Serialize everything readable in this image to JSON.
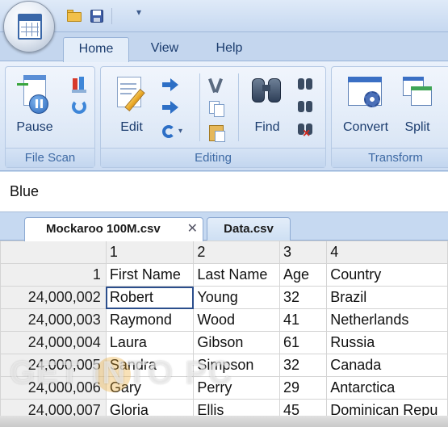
{
  "quick_access": {
    "open_icon": "folder-icon",
    "save_icon": "save-disk-icon",
    "more_glyph": "▾"
  },
  "ribbon_tabs": [
    {
      "label": "Home",
      "active": true
    },
    {
      "label": "View",
      "active": false
    },
    {
      "label": "Help",
      "active": false
    }
  ],
  "groups": {
    "file_scan": {
      "label": "File Scan",
      "pause_label": "Pause"
    },
    "editing": {
      "label": "Editing",
      "edit_label": "Edit",
      "find_label": "Find",
      "undo_dropdown": "▾"
    },
    "transform": {
      "label": "Transform",
      "convert_label": "Convert",
      "split_label": "Split"
    }
  },
  "value_bar": {
    "text": "Blue"
  },
  "document_tabs": [
    {
      "label": "Mockaroo 100M.csv",
      "active": true,
      "close": "✕"
    },
    {
      "label": "Data.csv",
      "active": false
    }
  ],
  "grid": {
    "column_headers": [
      "",
      "1",
      "2",
      "3",
      "4"
    ],
    "rows": [
      {
        "row": "1",
        "cells": [
          "First Name",
          "Last Name",
          "Age",
          "Country"
        ]
      },
      {
        "row": "24,000,002",
        "cells": [
          "Robert",
          "Young",
          "32",
          "Brazil"
        ]
      },
      {
        "row": "24,000,003",
        "cells": [
          "Raymond",
          "Wood",
          "41",
          "Netherlands"
        ]
      },
      {
        "row": "24,000,004",
        "cells": [
          "Laura",
          "Gibson",
          "61",
          "Russia"
        ]
      },
      {
        "row": "24,000,005",
        "cells": [
          "Sandra",
          "Simpson",
          "32",
          "Canada"
        ]
      },
      {
        "row": "24,000,006",
        "cells": [
          "Gary",
          "Perry",
          "29",
          "Antarctica"
        ]
      },
      {
        "row": "24,000,007",
        "cells": [
          "Gloria",
          "Ellis",
          "45",
          "Dominican Repu"
        ]
      }
    ],
    "selected_cell": "24,000,002/First Name"
  },
  "watermark": {
    "text": "GET INTO PC"
  }
}
